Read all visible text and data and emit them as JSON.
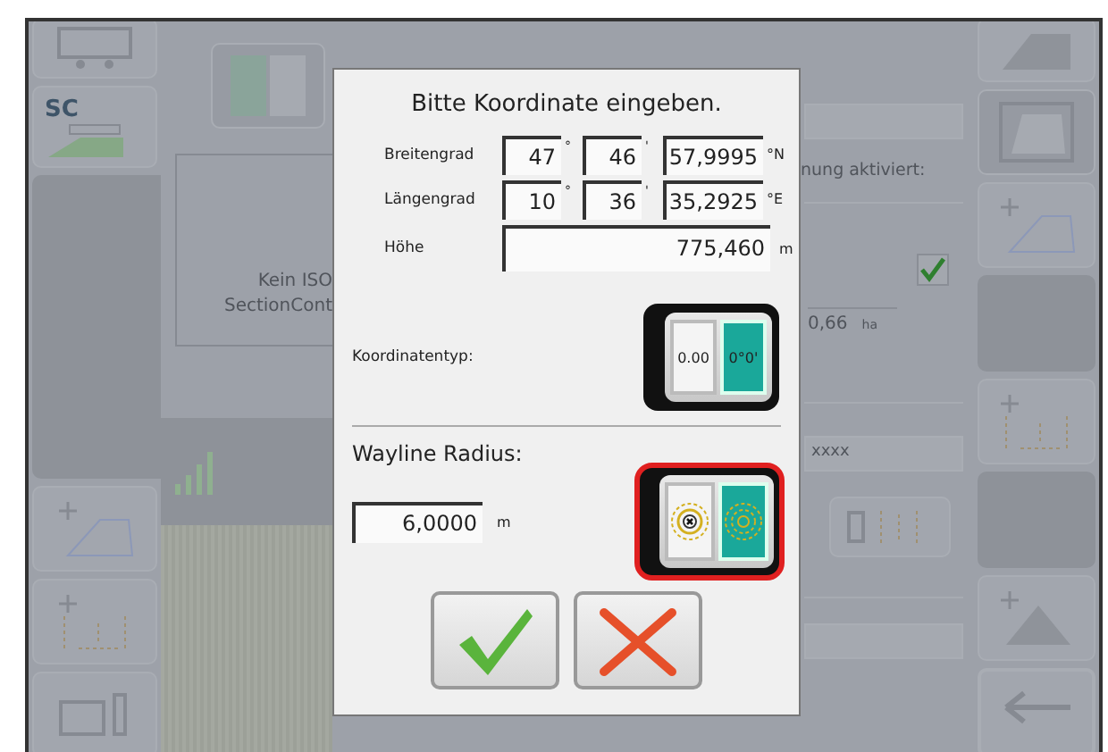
{
  "background": {
    "sc_label": "SC",
    "notice": [
      "Kein ISO",
      "SectionCont"
    ],
    "status_label": "nung aktiviert:",
    "checkbox": {
      "checked": true
    },
    "area": {
      "value": "0,66",
      "unit": "ha"
    },
    "name_field": {
      "value": "xxxx"
    }
  },
  "dialog": {
    "title": "Bitte Koordinate eingeben.",
    "coordinates": [
      {
        "label": "Breitengrad",
        "degrees": "47",
        "degree_sign": "°",
        "minutes": "46",
        "minute_sign": "'",
        "seconds": "57,9995",
        "unit": "°N"
      },
      {
        "label": "Längengrad",
        "degrees": "10",
        "degree_sign": "°",
        "minutes": "36",
        "minute_sign": "'",
        "seconds": "35,2925",
        "unit": "°E"
      }
    ],
    "altitude": {
      "label": "Höhe",
      "value": "775,460",
      "unit": "m"
    },
    "coordinate_type": {
      "label": "Koordinatentyp:",
      "highlighted": false,
      "options": [
        {
          "kind": "text",
          "label": "0.00",
          "selected": false
        },
        {
          "kind": "text",
          "label": "0°0'",
          "selected": true
        }
      ]
    },
    "wayline": {
      "label": "Wayline Radius:",
      "value": "6,0000",
      "unit": "m",
      "toggle": {
        "highlighted": true,
        "options": [
          {
            "kind": "target-cross",
            "selected": false
          },
          {
            "kind": "target",
            "selected": true
          }
        ]
      }
    },
    "buttons": [
      {
        "kind": "ok"
      },
      {
        "kind": "cancel"
      }
    ]
  }
}
